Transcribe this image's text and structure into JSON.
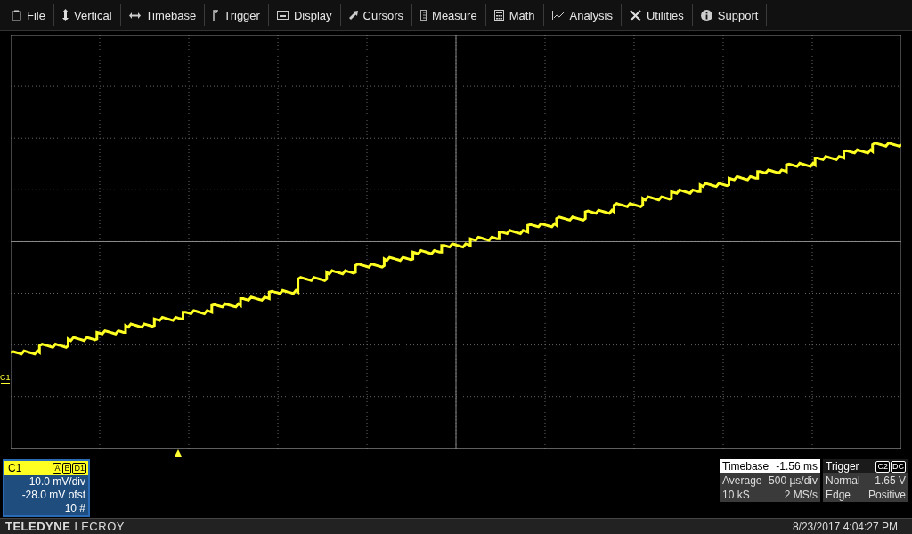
{
  "menu": [
    {
      "label": "File"
    },
    {
      "label": "Vertical"
    },
    {
      "label": "Timebase"
    },
    {
      "label": "Trigger"
    },
    {
      "label": "Display"
    },
    {
      "label": "Cursors"
    },
    {
      "label": "Measure"
    },
    {
      "label": "Math"
    },
    {
      "label": "Analysis"
    },
    {
      "label": "Utilities"
    },
    {
      "label": "Support"
    }
  ],
  "plot": {
    "ground_marker": "C1"
  },
  "channel": {
    "name": "C1",
    "badges": [
      "A",
      "B",
      "D1"
    ],
    "lines": [
      "10.0 mV/div",
      "-28.0 mV ofst",
      "10 #"
    ]
  },
  "timebase": {
    "title": "Timebase",
    "value": "-1.56 ms",
    "rows": [
      [
        "Average",
        "500 µs/div"
      ],
      [
        "10 kS",
        "2 MS/s"
      ]
    ]
  },
  "trigger": {
    "title": "Trigger",
    "badges": [
      "C2",
      "DC"
    ],
    "rows": [
      [
        "Normal",
        "1.65 V"
      ],
      [
        "Edge",
        "Positive"
      ]
    ]
  },
  "footer": {
    "brand_bold": "TELEDYNE",
    "brand": "LECROY",
    "datetime": "8/23/2017 4:04:27 PM"
  }
}
